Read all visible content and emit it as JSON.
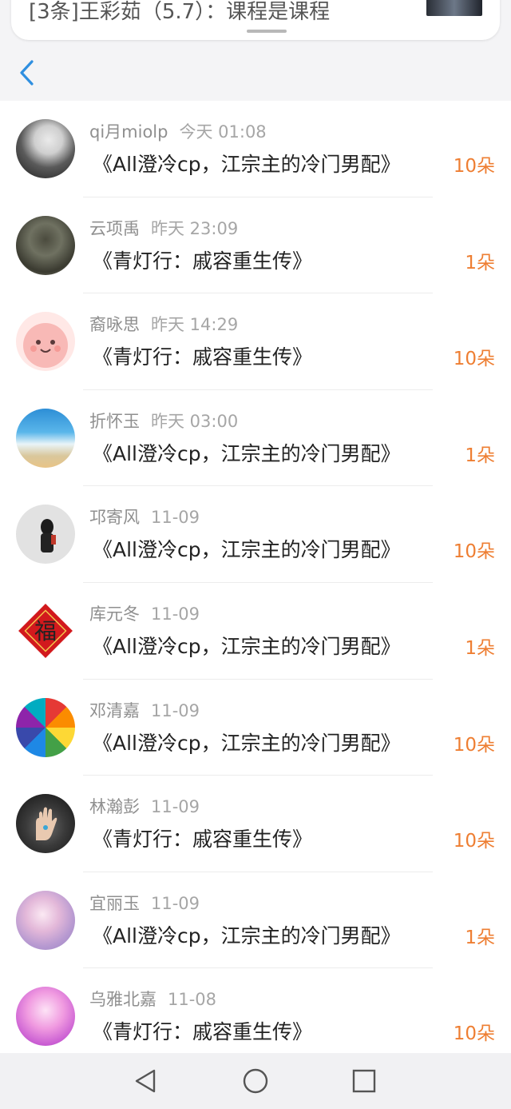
{
  "notification": {
    "text": "[3条]王彩茹（5.7）：课程是课程"
  },
  "header": {
    "back_icon": "chevron-left-icon",
    "accent": "#2f8fe0"
  },
  "gifts": [
    {
      "user": "qi月miolp",
      "time": "今天 01:08",
      "title": "《All澄冷cp，江宗主的冷门男配》",
      "amount": "10朵"
    },
    {
      "user": "云项禹",
      "time": "昨天 23:09",
      "title": "《青灯行：戚容重生传》",
      "amount": "1朵"
    },
    {
      "user": "裔咏思",
      "time": "昨天 14:29",
      "title": "《青灯行：戚容重生传》",
      "amount": "10朵"
    },
    {
      "user": "折怀玉",
      "time": "昨天 03:00",
      "title": "《All澄冷cp，江宗主的冷门男配》",
      "amount": "1朵"
    },
    {
      "user": "邛寄风",
      "time": "11-09",
      "title": "《All澄冷cp，江宗主的冷门男配》",
      "amount": "10朵"
    },
    {
      "user": "库元冬",
      "time": "11-09",
      "title": "《All澄冷cp，江宗主的冷门男配》",
      "amount": "1朵"
    },
    {
      "user": "邓清嘉",
      "time": "11-09",
      "title": "《All澄冷cp，江宗主的冷门男配》",
      "amount": "10朵"
    },
    {
      "user": "林瀚彭",
      "time": "11-09",
      "title": "《青灯行：戚容重生传》",
      "amount": "10朵"
    },
    {
      "user": "宜丽玉",
      "time": "11-09",
      "title": "《All澄冷cp，江宗主的冷门男配》",
      "amount": "1朵"
    },
    {
      "user": "乌雅北嘉",
      "time": "11-08",
      "title": "《青灯行：戚容重生传》",
      "amount": "10朵"
    }
  ],
  "colors": {
    "amount": "#ee7e32",
    "meta": "#8f8f8f"
  },
  "system_nav": {
    "back_icon": "triangle-back-icon",
    "home_icon": "circle-home-icon",
    "recents_icon": "square-recents-icon"
  }
}
